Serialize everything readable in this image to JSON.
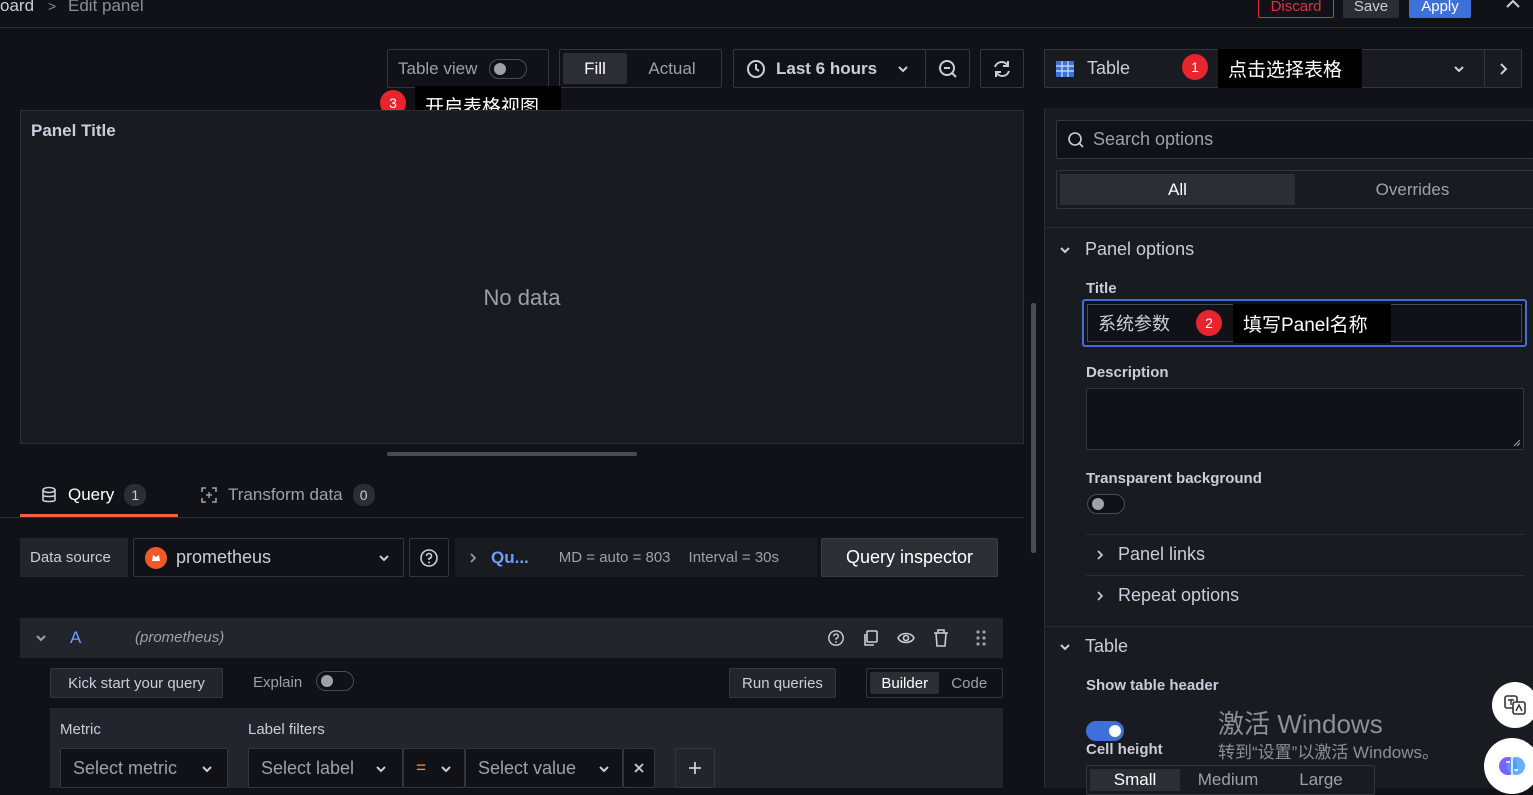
{
  "breadcrumb": {
    "parent": "oard",
    "separator": ">",
    "current": "Edit panel"
  },
  "header_buttons": {
    "discard": "Discard",
    "save": "Save",
    "apply": "Apply"
  },
  "toolbar": {
    "table_view_label": "Table view",
    "fill_label": "Fill",
    "actual_label": "Actual",
    "time_range": "Last 6 hours",
    "viz_label": "Table"
  },
  "callouts": {
    "c1_num": "1",
    "c1_text": "点击选择表格",
    "c2_num": "2",
    "c2_text": "填写Panel名称",
    "c3_num": "3",
    "c3_text": "开启表格视图"
  },
  "preview": {
    "title": "Panel Title",
    "empty": "No data"
  },
  "tabs": {
    "query_label": "Query",
    "query_count": "1",
    "transform_label": "Transform data",
    "transform_count": "0"
  },
  "datasource": {
    "label": "Data source",
    "name": "prometheus",
    "options_short": "Qu...",
    "md": "MD = auto = 803",
    "interval": "Interval = 30s",
    "inspector": "Query inspector"
  },
  "query_row": {
    "ref": "A",
    "ds": "(prometheus)",
    "kick_start": "Kick start your query",
    "explain": "Explain",
    "run": "Run queries",
    "builder": "Builder",
    "code": "Code",
    "metric_label": "Metric",
    "label_filters": "Label filters",
    "select_metric": "Select metric",
    "select_label": "Select label",
    "operator": "=",
    "select_value": "Select value"
  },
  "options": {
    "search_placeholder": "Search options",
    "tab_all": "All",
    "tab_overrides": "Overrides",
    "panel_options": "Panel options",
    "title_label": "Title",
    "title_value": "系统参数",
    "description_label": "Description",
    "transparent_label": "Transparent background",
    "panel_links": "Panel links",
    "repeat_options": "Repeat options",
    "table_section": "Table",
    "show_header": "Show table header",
    "cell_height": "Cell height",
    "cell_small": "Small",
    "cell_medium": "Medium",
    "cell_large": "Large"
  },
  "watermark": {
    "line1": "激活 Windows",
    "line2": "转到“设置”以激活 Windows。"
  },
  "colors": {
    "accent": "#3d71d9",
    "brand_orange": "#f05a28",
    "callout_red": "#e8242f",
    "discard_red": "#e02f44"
  }
}
